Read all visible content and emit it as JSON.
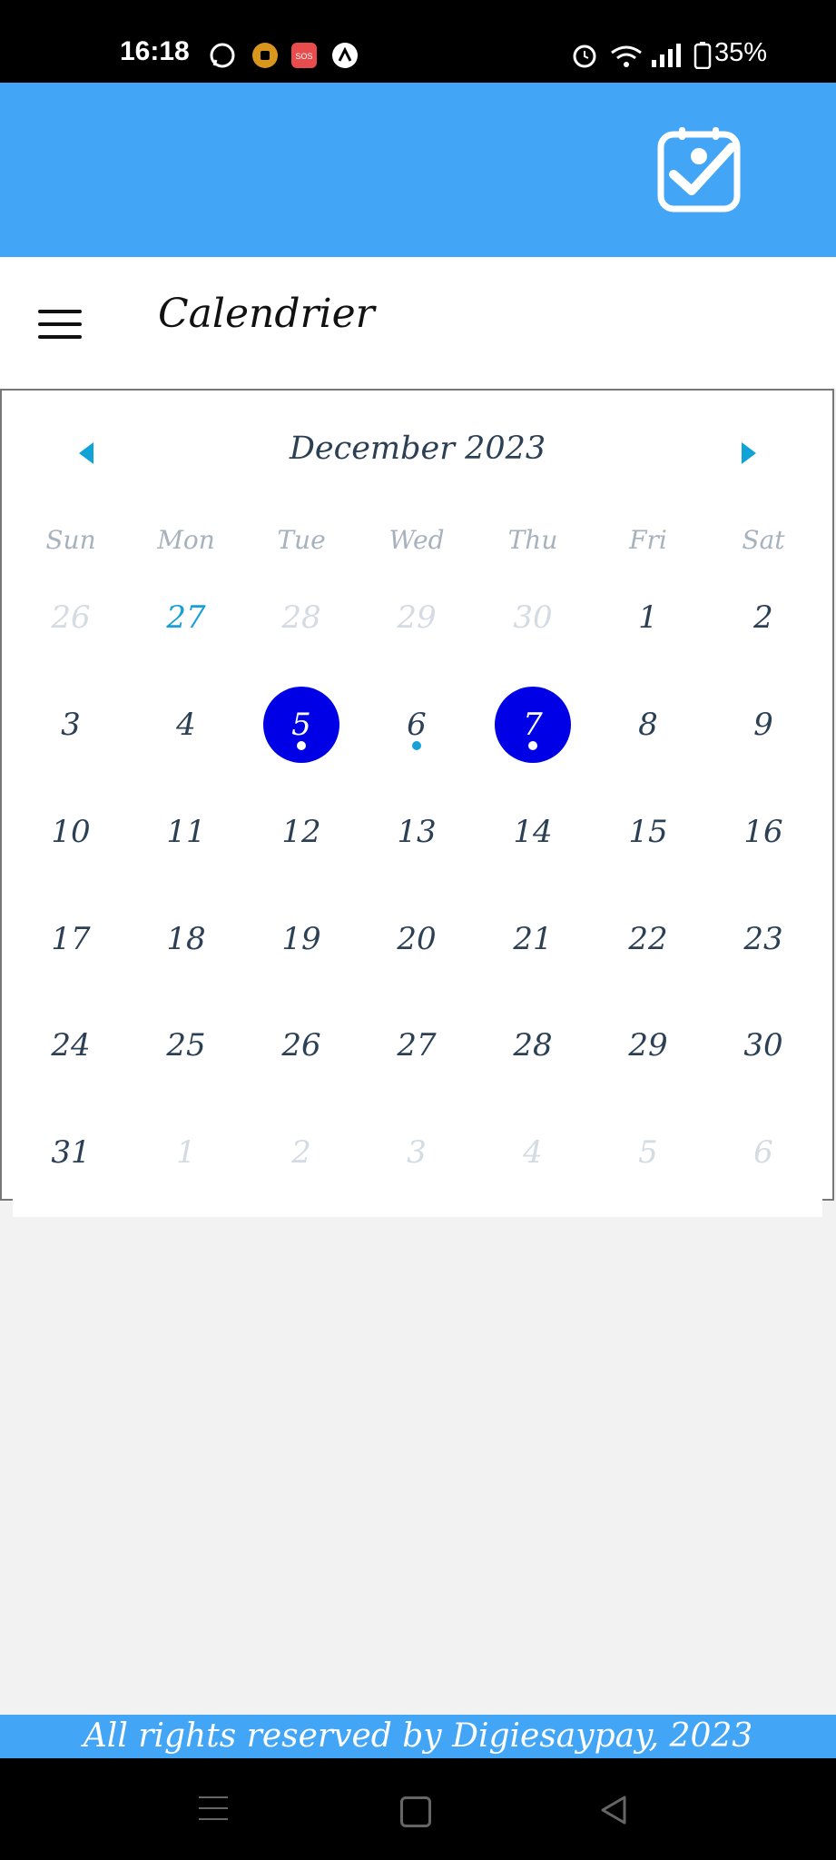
{
  "status_bar": {
    "time": "16:18",
    "battery": "35%",
    "icons_left": [
      "whatsapp-icon",
      "app-icon",
      "sos-icon",
      "nav-app-icon"
    ],
    "icons_right": [
      "alarm-icon",
      "wifi-icon",
      "signal-icon",
      "battery-icon"
    ]
  },
  "header": {
    "logo_icon": "calendar-check-icon"
  },
  "title_bar": {
    "title": "Calendrier"
  },
  "calendar": {
    "month_label": "December 2023",
    "weekdays": [
      "Sun",
      "Mon",
      "Tue",
      "Wed",
      "Thu",
      "Fri",
      "Sat"
    ],
    "weeks": [
      [
        "26",
        "27",
        "28",
        "29",
        "30",
        "1",
        "2"
      ],
      [
        "3",
        "4",
        "5",
        "6",
        "7",
        "8",
        "9"
      ],
      [
        "10",
        "11",
        "12",
        "13",
        "14",
        "15",
        "16"
      ],
      [
        "17",
        "18",
        "19",
        "20",
        "21",
        "22",
        "23"
      ],
      [
        "24",
        "25",
        "26",
        "27",
        "28",
        "29",
        "30"
      ],
      [
        "31",
        "1",
        "2",
        "3",
        "4",
        "5",
        "6"
      ]
    ],
    "today": "27",
    "selected_days": [
      "5",
      "7"
    ],
    "event_days": [
      "5",
      "6",
      "7"
    ],
    "colors": {
      "selected": "#0000e6",
      "today": "#1aa0d8",
      "header": "#42a5f5"
    }
  },
  "footer": {
    "text": "All rights reserved by Digiesaypay, 2023"
  }
}
